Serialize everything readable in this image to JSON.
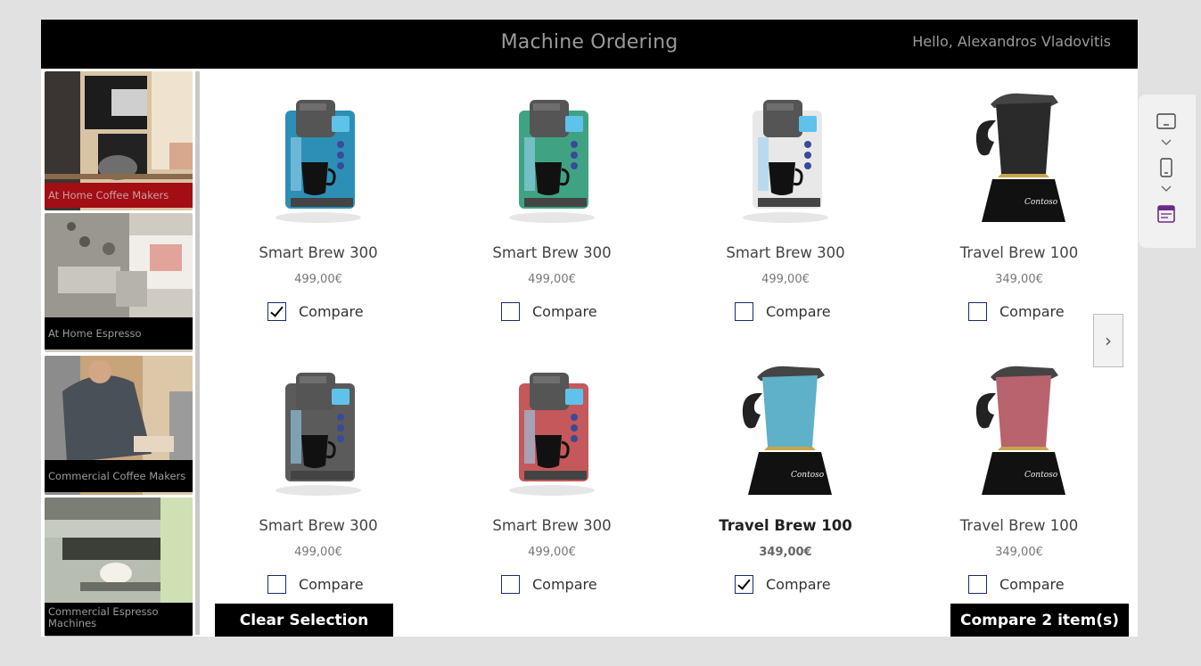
{
  "header": {
    "title": "Machine Ordering",
    "greeting": "Hello, Alexandros Vladovitis"
  },
  "sidebar": {
    "categories": [
      {
        "label": "At Home Coffee Makers",
        "selected": true
      },
      {
        "label": "At Home Espresso Machines",
        "selected": false
      },
      {
        "label": "Commercial Coffee Makers",
        "selected": false
      },
      {
        "label": "Commercial Espresso Machines",
        "selected": false
      }
    ]
  },
  "products": [
    {
      "name": "Smart Brew 300",
      "price": "499,00€",
      "compare_label": "Compare",
      "checked": true,
      "color": "#2d8fb5",
      "kind": "brewer"
    },
    {
      "name": "Smart Brew 300",
      "price": "499,00€",
      "compare_label": "Compare",
      "checked": false,
      "color": "#3fa383",
      "kind": "brewer"
    },
    {
      "name": "Smart Brew 300",
      "price": "499,00€",
      "compare_label": "Compare",
      "checked": false,
      "color": "#e8e8e8",
      "kind": "brewer"
    },
    {
      "name": "Travel Brew 100",
      "price": "349,00€",
      "compare_label": "Compare",
      "checked": false,
      "color": "#2a2a2a",
      "kind": "moka"
    },
    {
      "name": "Smart Brew 300",
      "price": "499,00€",
      "compare_label": "Compare",
      "checked": false,
      "color": "#5b5b5b",
      "kind": "brewer"
    },
    {
      "name": "Smart Brew 300",
      "price": "499,00€",
      "compare_label": "Compare",
      "checked": false,
      "color": "#c4585a",
      "kind": "brewer"
    },
    {
      "name": "Travel Brew 100",
      "price": "349,00€",
      "compare_label": "Compare",
      "checked": true,
      "color": "#5fb0c9",
      "kind": "moka",
      "highlighted": true
    },
    {
      "name": "Travel Brew 100",
      "price": "349,00€",
      "compare_label": "Compare",
      "checked": false,
      "color": "#b8636e",
      "kind": "moka"
    }
  ],
  "actions": {
    "clear_label": "Clear Selection",
    "compare_label": "Compare 2 item(s)"
  },
  "colors": {
    "header_bg": "#000000",
    "selected_category": "#a30d14",
    "checkbox_border": "#1a2a6c"
  },
  "icons": {
    "next": "chevron-right-icon",
    "panel": [
      "tablet-icon",
      "phone-icon",
      "form-icon"
    ]
  }
}
